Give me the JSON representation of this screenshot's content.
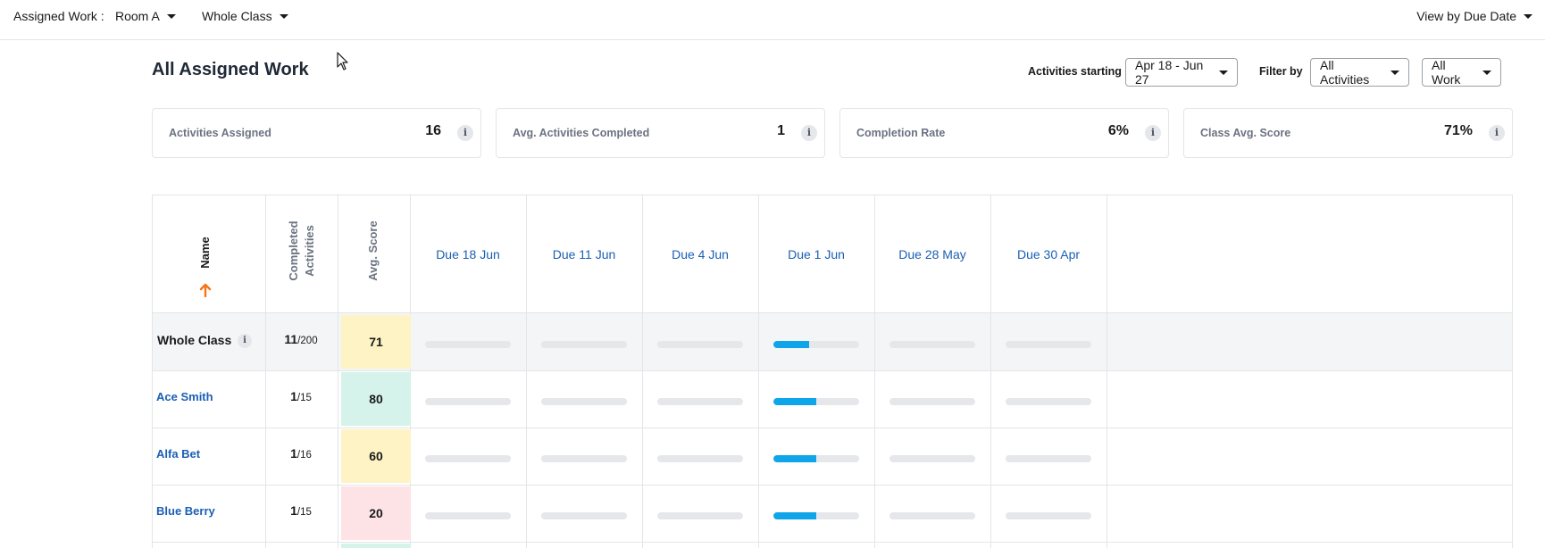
{
  "topbar": {
    "label": "Assigned Work :",
    "room": "Room A",
    "group": "Whole Class",
    "view": "View by Due Date"
  },
  "heading": {
    "title": "All Assigned Work",
    "activities_starting_label": "Activities starting",
    "date_range": "Apr 18 - Jun 27",
    "filter_by_label": "Filter by",
    "activity_filter": "All Activities",
    "work_filter": "All Work"
  },
  "stats": [
    {
      "label": "Activities Assigned",
      "value": "16"
    },
    {
      "label": "Avg. Activities Completed",
      "value": "1"
    },
    {
      "label": "Completion Rate",
      "value": "6%"
    },
    {
      "label": "Class Avg. Score",
      "value": "71%"
    }
  ],
  "table": {
    "col_name": "Name",
    "col_completed_1": "Completed",
    "col_completed_2": "Activities",
    "col_avg": "Avg. Score",
    "due": [
      "Due 18 Jun",
      "Due 11 Jun",
      "Due 4 Jun",
      "Due 1 Jun",
      "Due 28 May",
      "Due 30 Apr"
    ],
    "whole_class": {
      "name": "Whole Class",
      "completed": "11",
      "total": "/200",
      "score": "71",
      "score_color": "#fdf3c4"
    },
    "students": [
      {
        "name": "Ace Smith",
        "completed": "1",
        "total": "/15",
        "score": "80",
        "score_color": "#d5f3ea"
      },
      {
        "name": "Alfa Bet",
        "completed": "1",
        "total": "/16",
        "score": "60",
        "score_color": "#fdf3c4"
      },
      {
        "name": "Blue Berry",
        "completed": "1",
        "total": "/15",
        "score": "20",
        "score_color": "#fde2e6"
      }
    ],
    "progress": {
      "whole_class": [
        0,
        0,
        0,
        0.42,
        0,
        0
      ],
      "students": [
        0.5,
        0.5,
        0.5
      ]
    },
    "next_row_score_color": "#d5f3ea"
  },
  "colors": {
    "accent_blue": "#1a5fb4",
    "progress": "#0ea5e9",
    "sort_arrow": "#f97316"
  }
}
